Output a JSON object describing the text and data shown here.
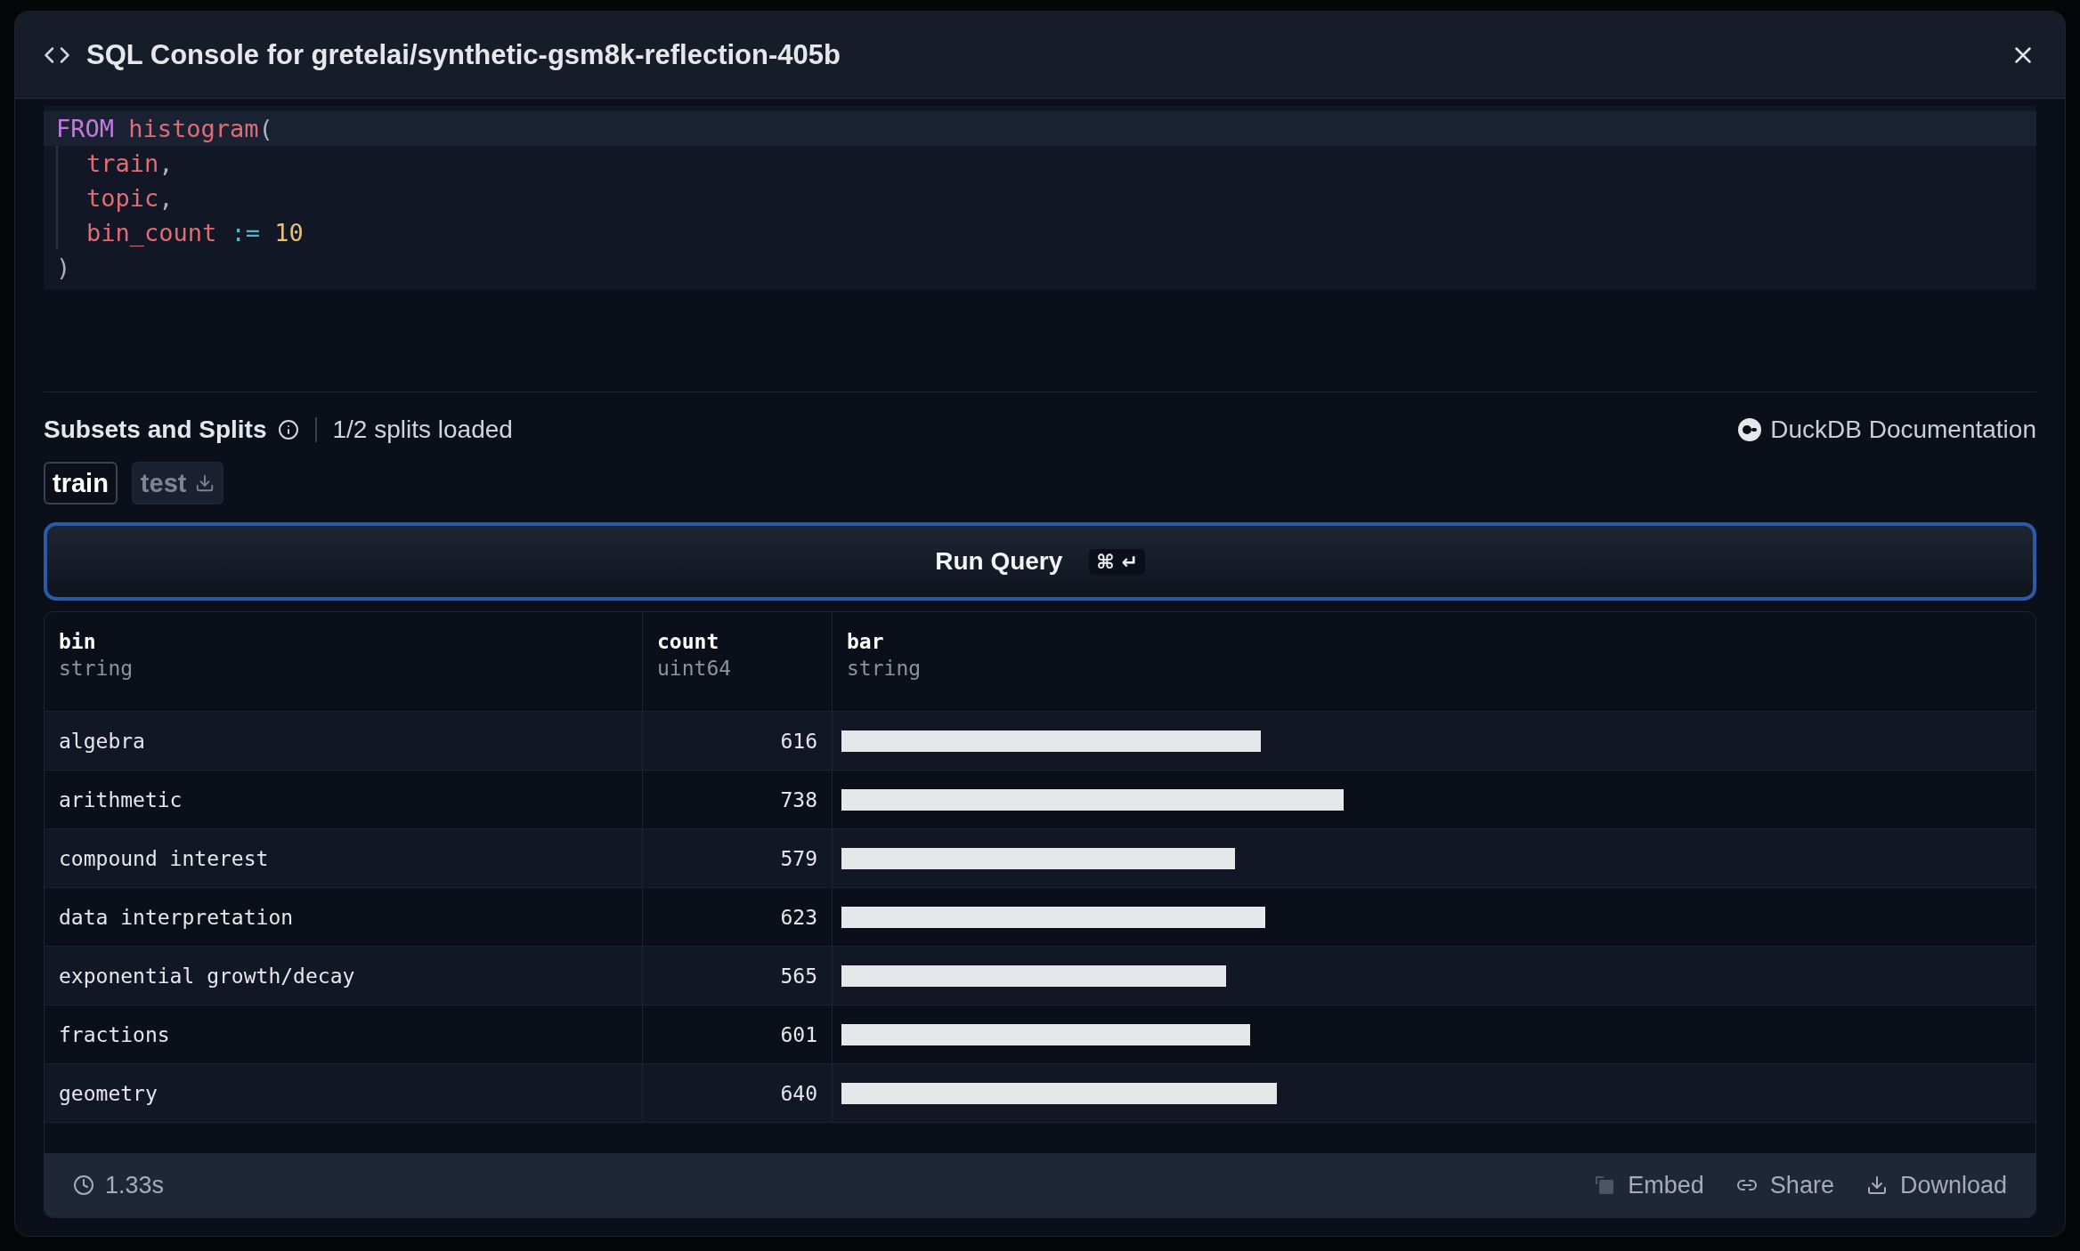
{
  "dialog": {
    "title": "SQL Console for gretelai/synthetic-gsm8k-reflection-405b"
  },
  "editor": {
    "lines": [
      {
        "active": true,
        "indented": false,
        "tokens": [
          {
            "text": "FROM",
            "kind": "keyword"
          },
          {
            "text": "histogram",
            "kind": "func",
            "spaced": true
          },
          {
            "text": "(",
            "kind": "punct"
          }
        ]
      },
      {
        "active": false,
        "indented": true,
        "tokens": [
          {
            "text": "train",
            "kind": "func"
          },
          {
            "text": ",",
            "kind": "punct"
          }
        ]
      },
      {
        "active": false,
        "indented": true,
        "tokens": [
          {
            "text": "topic",
            "kind": "func"
          },
          {
            "text": ",",
            "kind": "punct"
          }
        ]
      },
      {
        "active": false,
        "indented": true,
        "tokens": [
          {
            "text": "bin_count",
            "kind": "func"
          },
          {
            "text": ":=",
            "kind": "operator",
            "spaced": true
          },
          {
            "text": "10",
            "kind": "number",
            "spaced": true
          }
        ]
      },
      {
        "active": false,
        "indented": false,
        "tokens": [
          {
            "text": ")",
            "kind": "punct"
          }
        ]
      }
    ]
  },
  "splits": {
    "heading": "Subsets and Splits",
    "status": "1/2 splits loaded",
    "docs_link": "DuckDB Documentation",
    "items": [
      {
        "label": "train",
        "selected": true,
        "loaded": true
      },
      {
        "label": "test",
        "selected": false,
        "loaded": false
      }
    ]
  },
  "run_button": {
    "label": "Run Query",
    "shortcut": "⌘ ↵"
  },
  "table": {
    "columns": [
      {
        "name": "bin",
        "type": "string",
        "kind": "text"
      },
      {
        "name": "count",
        "type": "uint64",
        "kind": "number"
      },
      {
        "name": "bar",
        "type": "string",
        "kind": "bar"
      }
    ],
    "rows": [
      [
        {
          "text": "algebra"
        },
        {
          "text": "616"
        }
      ],
      [
        {
          "text": "arithmetic"
        },
        {
          "text": "738"
        }
      ],
      [
        {
          "text": "compound interest"
        },
        {
          "text": "579"
        }
      ],
      [
        {
          "text": "data interpretation"
        },
        {
          "text": "623"
        }
      ],
      [
        {
          "text": "exponential growth/decay"
        },
        {
          "text": "565"
        }
      ],
      [
        {
          "text": "fractions"
        },
        {
          "text": "601"
        }
      ],
      [
        {
          "text": "geometry"
        },
        {
          "text": "640"
        }
      ]
    ]
  },
  "footer": {
    "duration": "1.33s",
    "actions": [
      {
        "label": "Embed",
        "kind": "embed"
      },
      {
        "label": "Share",
        "kind": "share"
      },
      {
        "label": "Download",
        "kind": "download"
      }
    ]
  }
}
